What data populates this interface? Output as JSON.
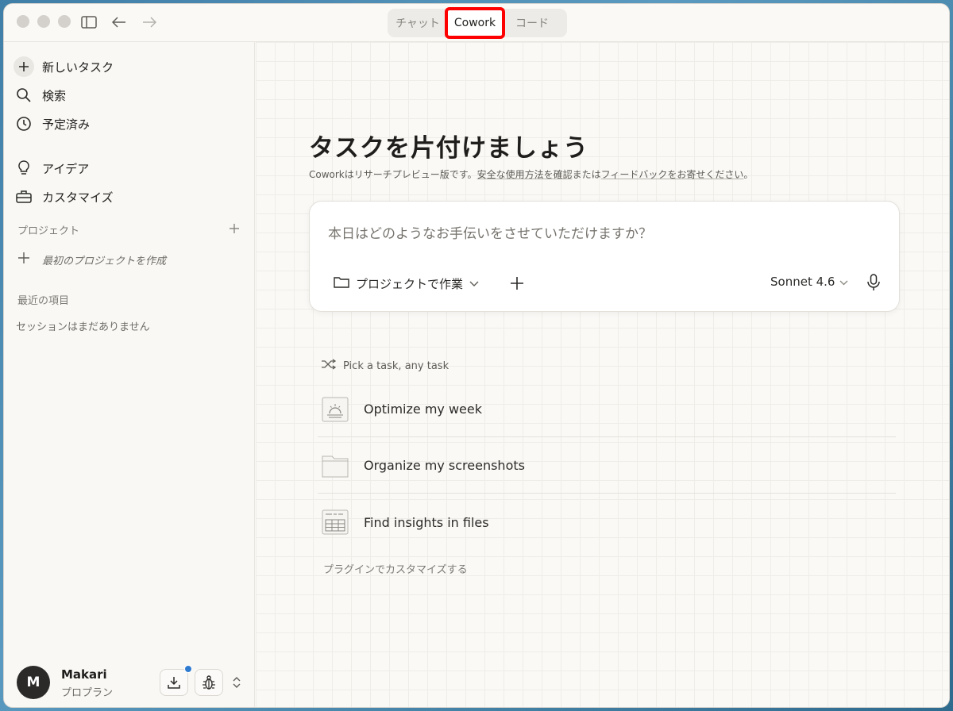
{
  "tabs": [
    {
      "label": "チャット"
    },
    {
      "label": "Cowork",
      "active": true
    },
    {
      "label": "コード"
    }
  ],
  "sidebar": {
    "new_task": "新しいタスク",
    "search": "検索",
    "scheduled": "予定済み",
    "ideas": "アイデア",
    "customize": "カスタマイズ",
    "projects_label": "プロジェクト",
    "create_project": "最初のプロジェクトを作成",
    "recent_label": "最近の項目",
    "no_sessions": "セッションはまだありません"
  },
  "user": {
    "initial": "M",
    "name": "Makari",
    "plan": "プロプラン"
  },
  "main": {
    "heading": "タスクを片付けましょう",
    "subtitle_prefix": "Coworkはリサーチプレビュー版です。",
    "subtitle_link1": "安全な使用方法を確認",
    "subtitle_mid": "または",
    "subtitle_link2": "フィードバックをお寄せください",
    "subtitle_suffix": "。",
    "composer_placeholder": "本日はどのようなお手伝いをさせていただけますか？",
    "project_button": "プロジェクトで作業",
    "model": "Sonnet 4.6",
    "pick_label": "Pick a task, any task",
    "tasks": [
      {
        "label": "Optimize my week",
        "icon": "sunrise-calendar-icon"
      },
      {
        "label": "Organize my screenshots",
        "icon": "folder-icon"
      },
      {
        "label": "Find insights in files",
        "icon": "spreadsheet-icon"
      }
    ],
    "plugin_link": "プラグインでカスタマイズする"
  },
  "colors": {
    "accent_highlight": "#ff0000",
    "notification_dot": "#2f7bd0",
    "avatar_bg": "#2b2a28"
  }
}
